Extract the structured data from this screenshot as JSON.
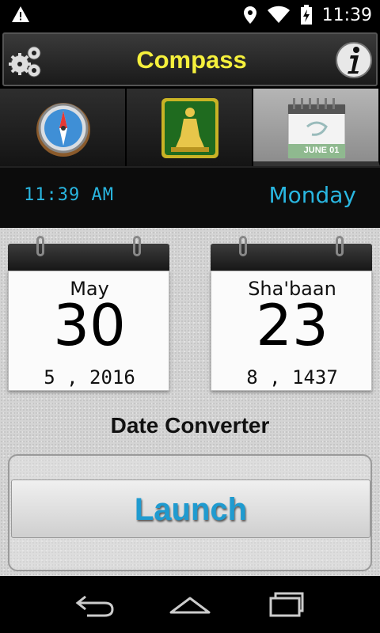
{
  "status_bar": {
    "time": "11:39",
    "icons": [
      "warning-icon",
      "location-icon",
      "wifi-icon",
      "battery-icon"
    ]
  },
  "header": {
    "title": "Compass",
    "title_color": "#f5f03c",
    "left_icon": "gear-icon",
    "right_icon": "info-icon"
  },
  "tabs": [
    {
      "name": "compass",
      "icon": "compass-icon",
      "active": false
    },
    {
      "name": "prayer",
      "icon": "prayer-icon",
      "active": false
    },
    {
      "name": "calendar",
      "icon": "calendar-icon",
      "active": true,
      "label": "JUNE 01"
    }
  ],
  "time_row": {
    "time": "11:39 AM",
    "day": "Monday",
    "accent_color": "#29b6e0"
  },
  "calendars": {
    "gregorian": {
      "month": "May",
      "day": "30",
      "year_line": "5 , 2016"
    },
    "hijri": {
      "month": "Sha'baan",
      "day": "23",
      "year_line": "8 , 1437"
    }
  },
  "converter": {
    "label": "Date Converter",
    "button_label": "Launch",
    "button_color": "#1f9bd0"
  },
  "nav": {
    "icons": [
      "back-icon",
      "home-icon",
      "recent-apps-icon"
    ]
  }
}
